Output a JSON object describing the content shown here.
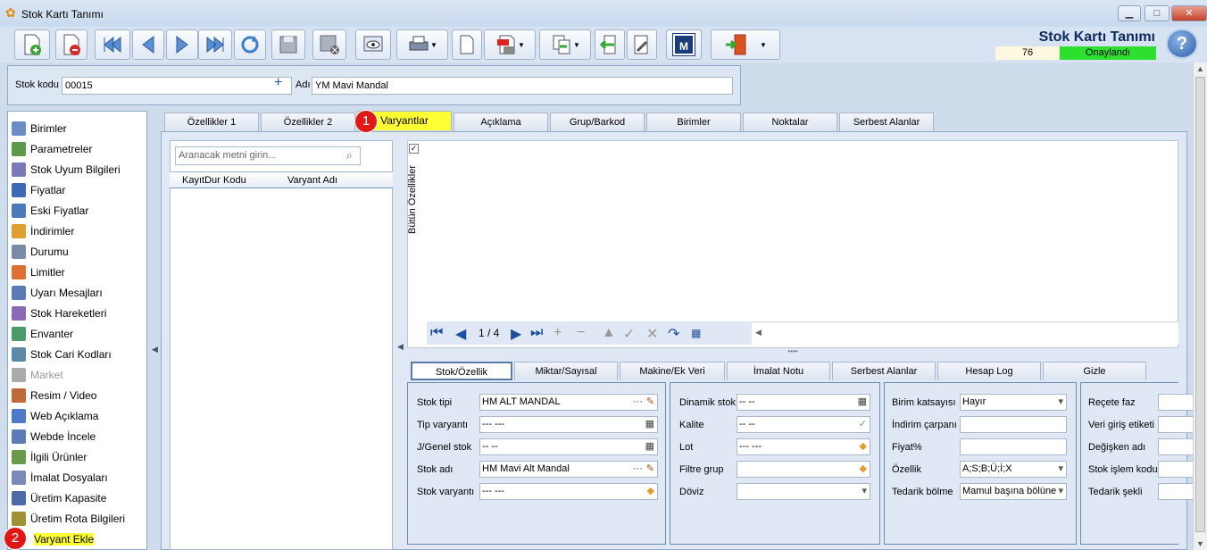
{
  "window": {
    "title": "Stok Kartı Tanımı",
    "minimize": "▁",
    "maximize": "□",
    "close": "✕"
  },
  "header": {
    "title": "Stok Kartı Tanımı",
    "record_number": "76",
    "status": "Onaylandı",
    "status_color": "#2ee02e"
  },
  "toolbar": {
    "icons": [
      "new-doc-icon",
      "delete-doc-icon",
      "first-icon",
      "prev-icon",
      "next-icon",
      "last-icon",
      "refresh-icon",
      "save-icon",
      "save-close-icon",
      "preview-icon",
      "print-icon",
      "document-icon",
      "pdf-icon",
      "copy-icon",
      "import-icon",
      "tools-icon",
      "m-icon",
      "exit-icon"
    ],
    "m_label": "M"
  },
  "stock": {
    "code_label": "Stok kodu",
    "code": "00015",
    "name_label": "Adı",
    "name": "YM Mavi Mandal"
  },
  "sidebar": {
    "items": [
      {
        "label": "Birimler",
        "icon": "units-icon"
      },
      {
        "label": "Parametreler",
        "icon": "parameters-icon"
      },
      {
        "label": "Stok Uyum Bilgileri",
        "icon": "compat-icon"
      },
      {
        "label": "Fiyatlar",
        "icon": "price-tag-icon"
      },
      {
        "label": "Eski Fiyatlar",
        "icon": "old-price-icon"
      },
      {
        "label": "İndirimler",
        "icon": "discount-icon"
      },
      {
        "label": "Durumu",
        "icon": "status-icon"
      },
      {
        "label": "Limitler",
        "icon": "limits-icon"
      },
      {
        "label": "Uyarı Mesajları",
        "icon": "warning-msg-icon"
      },
      {
        "label": "Stok Hareketleri",
        "icon": "movements-icon"
      },
      {
        "label": "Envanter",
        "icon": "inventory-icon"
      },
      {
        "label": "Stok Cari Kodları",
        "icon": "customer-codes-icon"
      },
      {
        "label": "Market",
        "icon": "cart-icon",
        "disabled": true
      },
      {
        "label": "Resim / Video",
        "icon": "media-icon"
      },
      {
        "label": "Web Açıklama",
        "icon": "web-icon"
      },
      {
        "label": "Webde İncele",
        "icon": "web-view-icon"
      },
      {
        "label": "İlgili Ürünler",
        "icon": "related-icon"
      },
      {
        "label": "İmalat Dosyaları",
        "icon": "manufacture-icon"
      },
      {
        "label": "Üretim Kapasite",
        "icon": "capacity-icon"
      },
      {
        "label": "Üretim Rota Bilgileri",
        "icon": "route-icon"
      },
      {
        "label": "Varyant Ekle",
        "icon": "",
        "highlight": true
      }
    ]
  },
  "tabs": [
    "Özellikler 1",
    "Özellikler 2",
    "Varyantlar",
    "Açıklama",
    "Grup/Barkod",
    "Birimler",
    "Noktalar",
    "Serbest Alanlar"
  ],
  "markers": {
    "one": "1",
    "two": "2"
  },
  "variants": {
    "search_placeholder": "Aranacak metni girin...",
    "columns": [
      "KayıtDur",
      "Kodu",
      "Varyant Adı"
    ],
    "vertical_label": "Bütün Özellikler",
    "pager": "1 / 4"
  },
  "subtabs": [
    "Stok/Özellik",
    "Miktar/Sayısal",
    "Makine/Ek Veri",
    "İmalat Notu",
    "Serbest Alanlar",
    "Hesap Log",
    "Gizle"
  ],
  "form": {
    "col1": [
      {
        "label": "Stok tipi",
        "value": "HM ALT MANDAL"
      },
      {
        "label": "Tip varyantı",
        "value": "--- ---"
      },
      {
        "label": "J/Genel stok",
        "value": "-- --"
      },
      {
        "label": "Stok adı",
        "value": "HM Mavi Alt Mandal"
      },
      {
        "label": "Stok varyantı",
        "value": "--- ---"
      }
    ],
    "col2": [
      {
        "label": "Dinamik stok",
        "value": "-- --"
      },
      {
        "label": "Kalite",
        "value": "-- --"
      },
      {
        "label": "Lot",
        "value": "--- ---"
      },
      {
        "label": "Filtre grup",
        "value": ""
      },
      {
        "label": "Döviz",
        "value": ""
      }
    ],
    "col3": [
      {
        "label": "Birim katsayısı",
        "value": "Hayır"
      },
      {
        "label": "İndirim çarpanı",
        "value": ""
      },
      {
        "label": "Fiyat%",
        "value": ""
      },
      {
        "label": "Özellik",
        "value": "A;S;B;Ü;İ;X"
      },
      {
        "label": "Tedarik bölme",
        "value": "Mamul başına bölüne"
      }
    ],
    "col4": [
      {
        "label": "Reçete faz",
        "value": ""
      },
      {
        "label": "Veri giriş etiketi",
        "value": ""
      },
      {
        "label": "Değişken adı",
        "value": ""
      },
      {
        "label": "Stok işlem kodu",
        "value": ""
      },
      {
        "label": "Tedarik şekli",
        "value": ""
      }
    ]
  }
}
